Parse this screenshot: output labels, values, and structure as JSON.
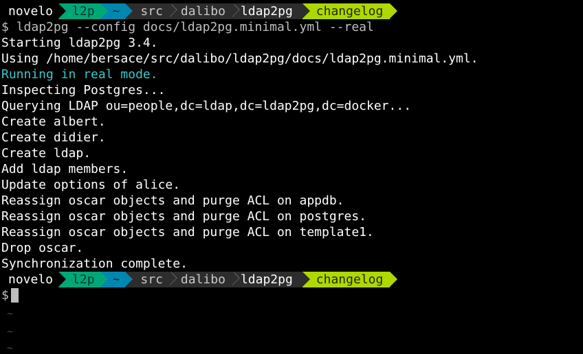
{
  "prompt": {
    "host": "novelo",
    "venv": "l2p",
    "home": "~",
    "path": [
      "src",
      "dalibo",
      "ldap2pg"
    ],
    "branch": "changelog"
  },
  "command": {
    "symbol": "$",
    "text": "ldap2pg --config docs/ldap2pg.minimal.yml --real"
  },
  "output": [
    "Starting ldap2pg 3.4.",
    "Using /home/bersace/src/dalibo/ldap2pg/docs/ldap2pg.minimal.yml.",
    "Running in real mode.",
    "Inspecting Postgres...",
    "Querying LDAP ou=people,dc=ldap,dc=ldap2pg,dc=docker...",
    "Create albert.",
    "Create didier.",
    "Create ldap.",
    "Add ldap members.",
    "Update options of alice.",
    "Reassign oscar objects and purge ACL on appdb.",
    "Reassign oscar objects and purge ACL on postgres.",
    "Reassign oscar objects and purge ACL on template1.",
    "Drop oscar.",
    "Synchronization complete."
  ],
  "empty_line_marker": "~",
  "colors": {
    "background": "#000000",
    "venv": "#00a877",
    "home": "#0087af",
    "path": "#2d2d2d",
    "branch": "#afd700",
    "info_text": "#3cc7c7"
  }
}
